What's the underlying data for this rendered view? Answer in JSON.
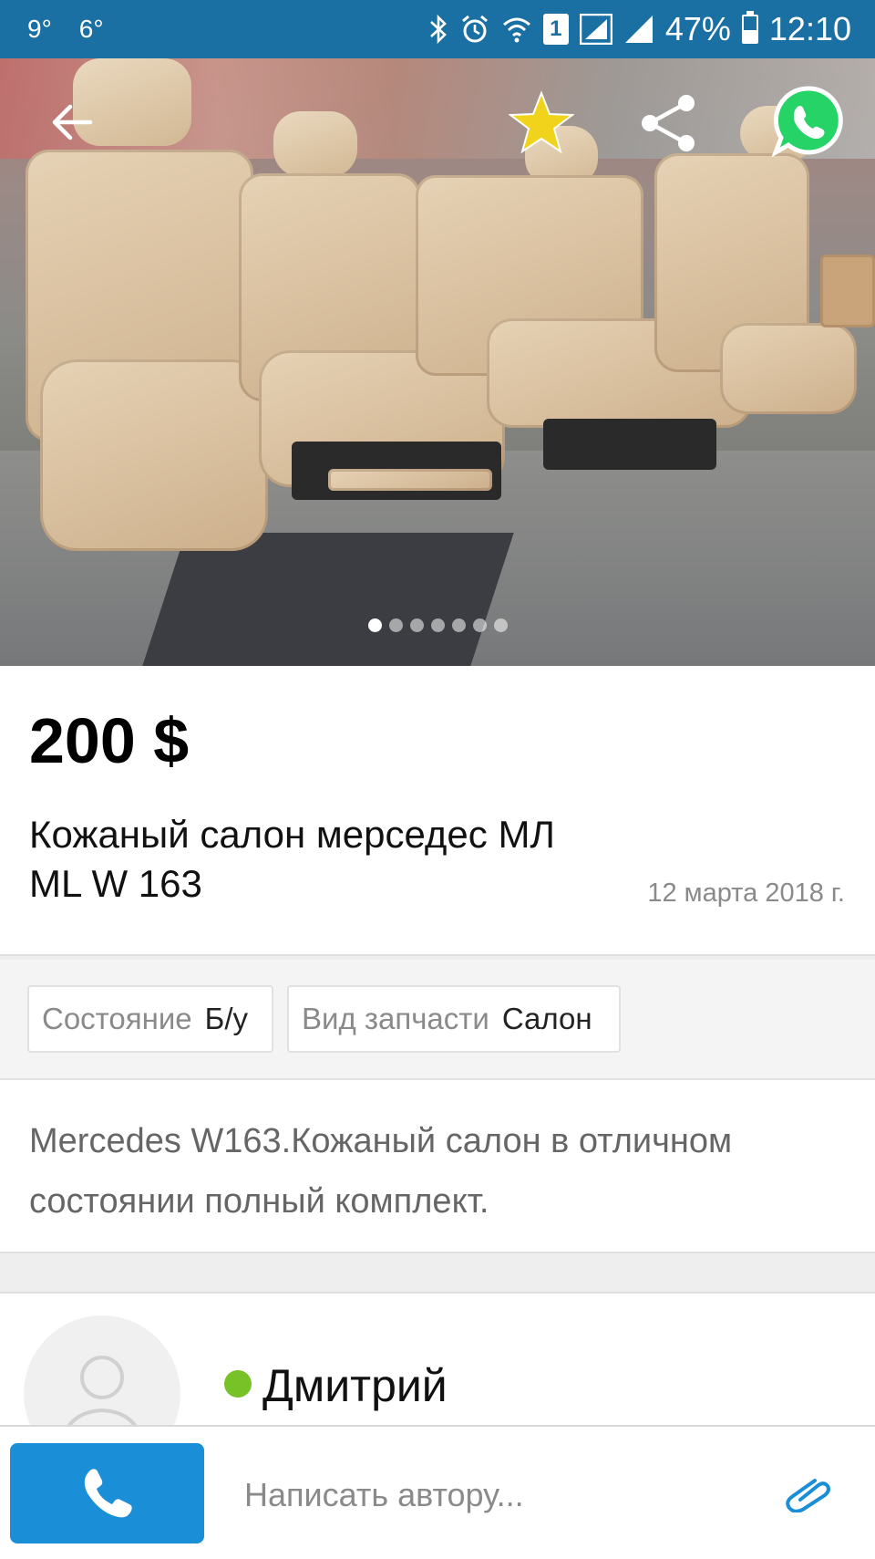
{
  "status_bar": {
    "temp_left": "9°",
    "temp_right": "6°",
    "battery": "47%",
    "battery_level": 0.47,
    "sim": "1",
    "time": "12:10",
    "icons": [
      "bluetooth-icon",
      "alarm-icon",
      "wifi-icon",
      "sim-icon",
      "signal-icon",
      "signal-icon",
      "battery-icon"
    ]
  },
  "gallery": {
    "photo_count": 7,
    "active_index": 0,
    "actions": [
      "back-arrow-icon",
      "favorite-star-icon",
      "share-icon",
      "whatsapp-icon"
    ]
  },
  "ad": {
    "price": "200 $",
    "title": "Кожаный салон мерседес МЛ ML W 163",
    "date": "12 марта 2018 г."
  },
  "params": [
    {
      "key": "Состояние",
      "value": "Б/у"
    },
    {
      "key": "Вид запчасти",
      "value": "Салон"
    }
  ],
  "description": "Mercedes W163.Кожаный салон в отличном состоянии полный комплект.",
  "seller": {
    "name": "Дмитрий",
    "online": true
  },
  "bottom_bar": {
    "message_placeholder": "Написать автору..."
  },
  "colors": {
    "status_bar": "#1a6fa3",
    "call_button": "#1a8ed6",
    "online": "#77c227",
    "star": "#f2d31c",
    "whatsapp": "#25d366"
  }
}
